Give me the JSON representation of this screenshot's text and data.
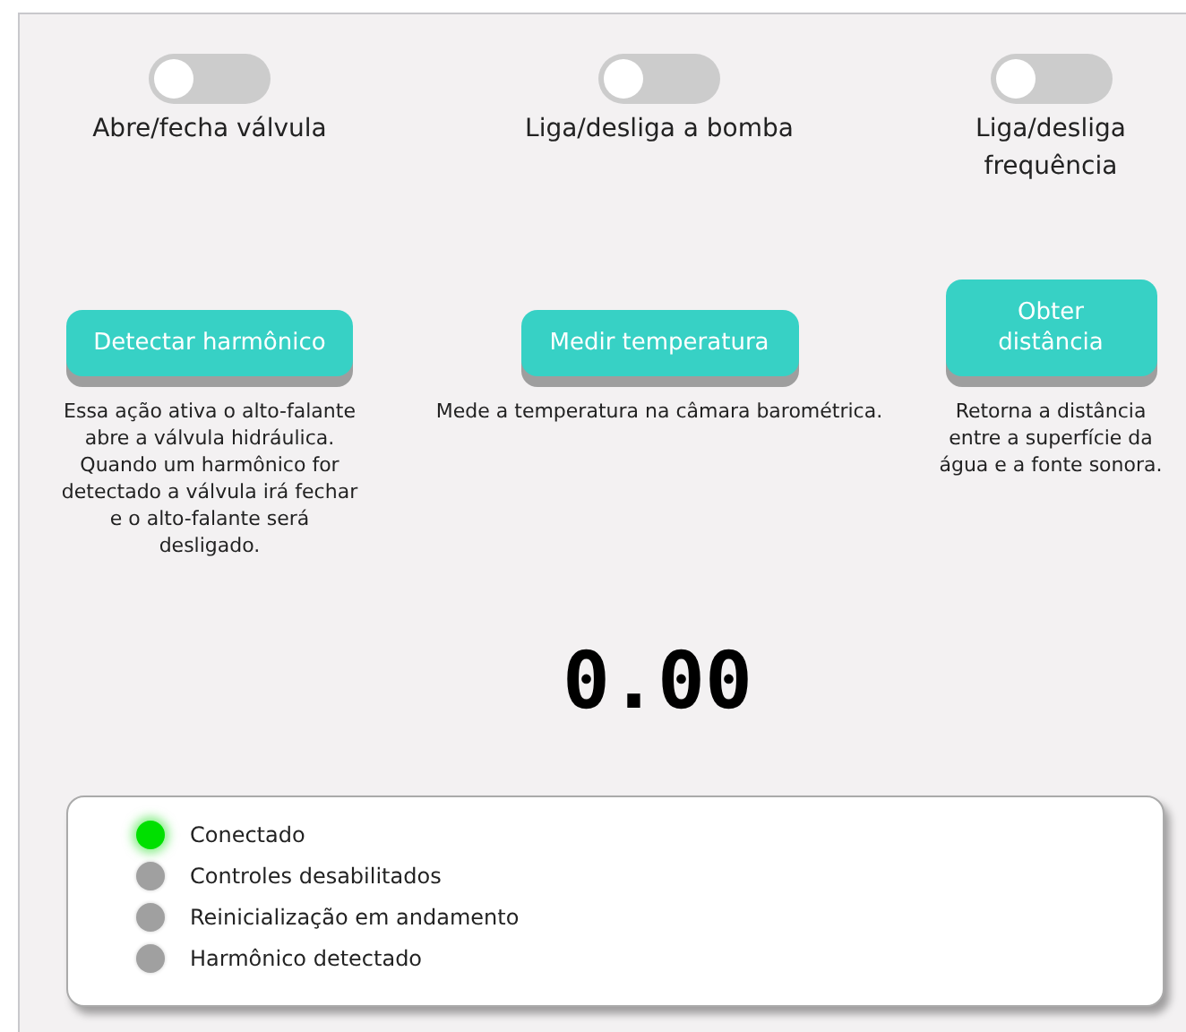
{
  "toggles": [
    {
      "label": "Abre/fecha válvula",
      "on": false
    },
    {
      "label": "Liga/desliga a bomba",
      "on": false
    },
    {
      "label": "Liga/desliga frequência",
      "on": false
    }
  ],
  "actions": [
    {
      "label": "Detectar harmônico",
      "description": "Essa ação ativa o alto-falante abre a válvula hidráulica. Quando um harmônico for detectado a válvula irá fechar e o alto-falante será desligado."
    },
    {
      "label": "Medir temperatura",
      "description": "Mede a temperatura na câmara barométrica."
    },
    {
      "label": "Obter distância",
      "description": "Retorna a distância entre a superfície da água e a fonte sonora."
    }
  ],
  "display": {
    "value": "0.00"
  },
  "status": [
    {
      "label": "Conectado",
      "on": true
    },
    {
      "label": "Controles desabilitados",
      "on": false
    },
    {
      "label": "Reinicialização em andamento",
      "on": false
    },
    {
      "label": "Harmônico detectado",
      "on": false
    }
  ]
}
